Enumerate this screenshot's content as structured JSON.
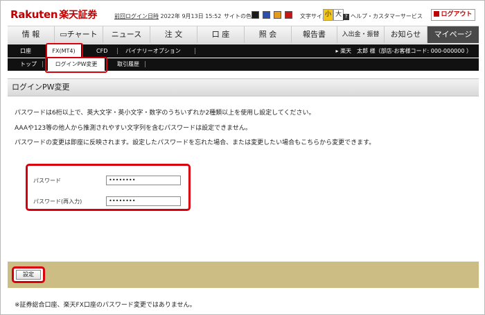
{
  "header": {
    "logo_latin": "Rakuten",
    "logo_kanji": "楽天証券",
    "last_login_link": "前回ログイン日時",
    "last_login_value": "2022年 9月13日 15:52",
    "site_color_label": "サイトの色",
    "site_colors": [
      "#1a1a1a",
      "#2f4fa8",
      "#e59a1c",
      "#c21818"
    ],
    "font_size_label": "文字サイズ",
    "font_size_small": "小",
    "font_size_large": "大",
    "help_label": "ヘルプ・カスタマーサービス",
    "help_icon": "question-icon",
    "logout_label": "ログアウト",
    "logout_icon": "logout-icon"
  },
  "main_nav": {
    "items": [
      "情 報",
      "チャート",
      "ニュース",
      "注 文",
      "口 座",
      "照 会",
      "報告書",
      "入出金・振替",
      "お知らせ",
      "マイページ"
    ],
    "active": "マイページ",
    "chart_icon": "chart-icon"
  },
  "sub_nav": {
    "items": [
      "口座",
      "FX(MT4)",
      "CFD",
      "バイナリーオプション"
    ],
    "active": "FX(MT4)",
    "user_prefix": "▸ 楽天　太郎 様（部店-お客様コード: 000-000000 ）"
  },
  "third_nav": {
    "items": [
      "トップ",
      "ログインPW変更",
      "取引履歴"
    ],
    "active": "ログインPW変更"
  },
  "page": {
    "title": "ログインPW変更",
    "descriptions": [
      "パスワードは6桁以上で、英大文字・英小文字・数字のうちいずれか2種類以上を使用し設定してください。",
      "AAAや123等の他人から推測されやすい文字列を含むパスワードは設定できません。",
      "パスワードの変更は即座に反映されます。設定したパスワードを忘れた場合、または変更したい場合もこちらから変更できます。"
    ],
    "form": {
      "password_label": "パスワード",
      "password_value": "••••••••",
      "password_confirm_label": "パスワード(再入力)",
      "password_confirm_value": "••••••••"
    },
    "submit_label": "設定",
    "note": "※証券総合口座、楽天FX口座のパスワード変更ではありません。"
  }
}
